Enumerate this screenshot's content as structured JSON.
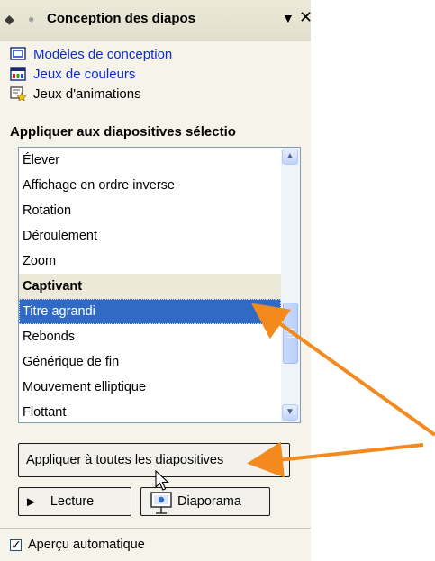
{
  "taskpane": {
    "title": "Conception des diapos",
    "back_icon": "back-arrow-icon",
    "forward_icon": "forward-arrow-icon",
    "dropdown_icon": "dropdown-triangle-icon",
    "close_icon": "close-icon"
  },
  "links": [
    {
      "label": "Modèles de conception",
      "icon": "design-template-icon",
      "is_link": true
    },
    {
      "label": "Jeux de couleurs",
      "icon": "color-scheme-icon",
      "is_link": true
    },
    {
      "label": "Jeux d'animations",
      "icon": "animation-scheme-icon",
      "is_link": false
    }
  ],
  "apply_section": {
    "heading": "Appliquer aux diapositives sélectio"
  },
  "animations_list": {
    "items": [
      {
        "label": "Élever",
        "type": "item"
      },
      {
        "label": "Affichage en ordre inverse",
        "type": "item"
      },
      {
        "label": "Rotation",
        "type": "item"
      },
      {
        "label": "Déroulement",
        "type": "item"
      },
      {
        "label": "Zoom",
        "type": "item"
      },
      {
        "label": "Captivant",
        "type": "category"
      },
      {
        "label": "Titre agrandi",
        "type": "selected"
      },
      {
        "label": "Rebonds",
        "type": "item"
      },
      {
        "label": "Générique de fin",
        "type": "item"
      },
      {
        "label": "Mouvement elliptique",
        "type": "item"
      },
      {
        "label": "Flottant",
        "type": "item"
      }
    ],
    "selected_label": "Titre agrandi"
  },
  "buttons": {
    "apply_all": "Appliquer à toutes les diapositives",
    "play": "Lecture",
    "slideshow": "Diaporama"
  },
  "autopreview": {
    "label": "Aperçu automatique",
    "checked": true
  },
  "colors": {
    "selection": "#316ac5",
    "link": "#0b2bd4",
    "pane_bg": "#f5f3ea",
    "annotation_arrow": "#f28a1e"
  }
}
